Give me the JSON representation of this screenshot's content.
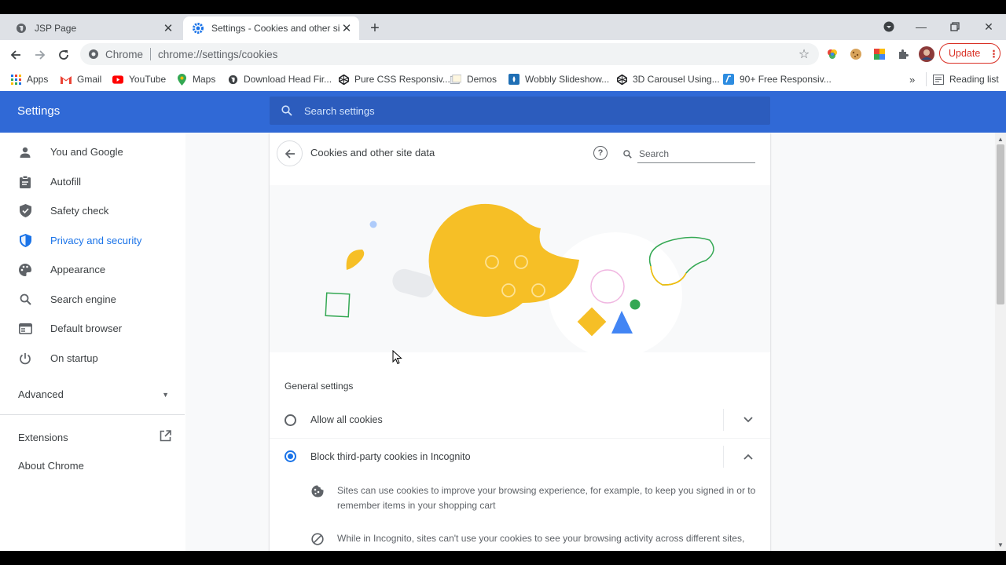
{
  "tabs": [
    {
      "title": "JSP Page",
      "icon": "globe-icon"
    },
    {
      "title": "Settings - Cookies and other site",
      "icon": "gear-icon"
    }
  ],
  "toolbar": {
    "omnibox_chrome": "Chrome",
    "url": "chrome://settings/cookies",
    "update_label": "Update"
  },
  "bookmarks": [
    {
      "label": "Apps",
      "icon": "apps-grid-icon"
    },
    {
      "label": "Gmail",
      "icon": "gmail-icon"
    },
    {
      "label": "YouTube",
      "icon": "youtube-icon"
    },
    {
      "label": "Maps",
      "icon": "maps-icon"
    },
    {
      "label": "Download Head Fir...",
      "icon": "globe-icon"
    },
    {
      "label": "Pure CSS Responsiv...",
      "icon": "codepen-icon"
    },
    {
      "label": "Demos",
      "icon": "demos-icon"
    },
    {
      "label": "Wobbly Slideshow...",
      "icon": "bookmark-icon"
    },
    {
      "label": "3D Carousel Using...",
      "icon": "codepen-icon"
    },
    {
      "label": "90+ Free Responsiv...",
      "icon": "bookmark-icon"
    }
  ],
  "reading_list": "Reading list",
  "settings": {
    "title": "Settings",
    "search_placeholder": "Search settings"
  },
  "sidebar": {
    "items": [
      {
        "label": "You and Google",
        "icon": "person-icon"
      },
      {
        "label": "Autofill",
        "icon": "clipboard-icon"
      },
      {
        "label": "Safety check",
        "icon": "shield-check-icon"
      },
      {
        "label": "Privacy and security",
        "icon": "shield-icon"
      },
      {
        "label": "Appearance",
        "icon": "palette-icon"
      },
      {
        "label": "Search engine",
        "icon": "search-icon"
      },
      {
        "label": "Default browser",
        "icon": "browser-icon"
      },
      {
        "label": "On startup",
        "icon": "power-icon"
      }
    ],
    "selected": "Privacy and security",
    "advanced": "Advanced",
    "extensions": "Extensions",
    "about": "About Chrome"
  },
  "page": {
    "title": "Cookies and other site data",
    "search_placeholder": "Search",
    "general_settings": "General settings",
    "options": [
      {
        "label": "Allow all cookies",
        "selected": false
      },
      {
        "label": "Block third-party cookies in Incognito",
        "selected": true
      }
    ],
    "details": [
      "Sites can use cookies to improve your browsing experience, for example, to keep you signed in or to remember items in your shopping cart",
      "While in Incognito, sites can't use your cookies to see your browsing activity across different sites,"
    ]
  },
  "colors": {
    "header_blue": "#3069d6",
    "accent_blue": "#1a73e8",
    "cookie_yellow": "#f6bf26",
    "update_red": "#d93025"
  }
}
